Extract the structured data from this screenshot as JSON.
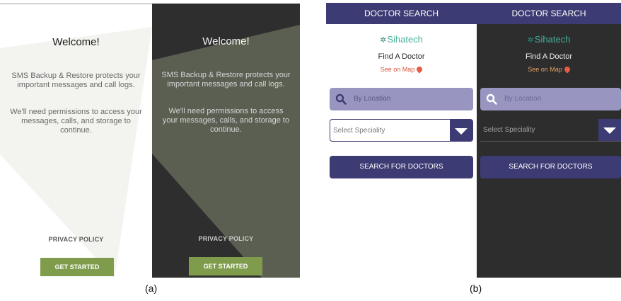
{
  "sms_app": {
    "title": "Welcome!",
    "paragraph_1": "SMS Backup & Restore protects your important messages and call logs.",
    "paragraph_2": "We'll need permissions to access your messages, calls, and storage to continue.",
    "privacy_label": "PRIVACY POLICY",
    "cta_label": "GET STARTED"
  },
  "doctor_app": {
    "header_title": "DOCTOR SEARCH",
    "logo_text": "Sihatech",
    "find_label": "Find A Doctor",
    "map_link": "See on Map",
    "location_placeholder": "By Location",
    "speciality_placeholder": "Select Speciality",
    "search_label": "SEARCH FOR DOCTORS"
  },
  "captions": {
    "a": "(a)",
    "b": "(b)"
  },
  "colors": {
    "accent_green": "#7e9c4c",
    "brand_navy": "#3d3b73",
    "location_bg": "#9896c0",
    "logo_teal": "#46b09d",
    "map_red": "#d5533a"
  },
  "icons": {
    "search": "search-icon",
    "pin": "map-pin-icon",
    "dropdown": "dropdown-arrow-icon",
    "logo": "sihatech-leaf-icon"
  }
}
